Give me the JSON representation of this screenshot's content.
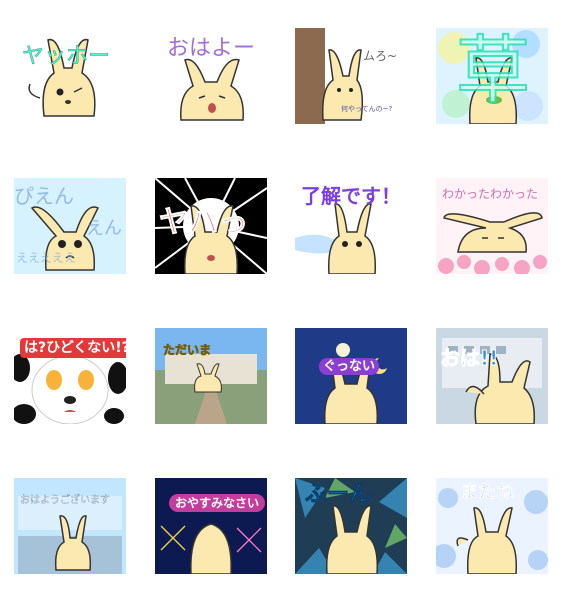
{
  "stickers": [
    {
      "id": "s1",
      "main": "ヤッホー",
      "sub": ""
    },
    {
      "id": "s2",
      "main": "おはよー",
      "sub": ""
    },
    {
      "id": "s3",
      "main": "ムろ~",
      "sub": "何やってんの~?"
    },
    {
      "id": "s4",
      "main": "草",
      "sub": ""
    },
    {
      "id": "s5",
      "main": "ぴえん",
      "sub": "えん",
      "extra": "えええええ"
    },
    {
      "id": "s6",
      "main": "ヤバっ",
      "sub": ""
    },
    {
      "id": "s7",
      "main": "了解です！",
      "sub": ""
    },
    {
      "id": "s8",
      "main": "わかったわかった",
      "sub": ""
    },
    {
      "id": "s9",
      "main": "は?ひどくない!?",
      "sub": ""
    },
    {
      "id": "s10",
      "main": "ただいま",
      "sub": ""
    },
    {
      "id": "s11",
      "main": "ぐっない",
      "sub": ""
    },
    {
      "id": "s12",
      "main": "おは!!",
      "sub": ""
    },
    {
      "id": "s13",
      "main": "おはようございます",
      "sub": ""
    },
    {
      "id": "s14",
      "main": "おやすみなさい",
      "sub": ""
    },
    {
      "id": "s15",
      "main": "ふーん",
      "sub": ""
    },
    {
      "id": "s16",
      "main": "またね",
      "sub": ""
    }
  ]
}
